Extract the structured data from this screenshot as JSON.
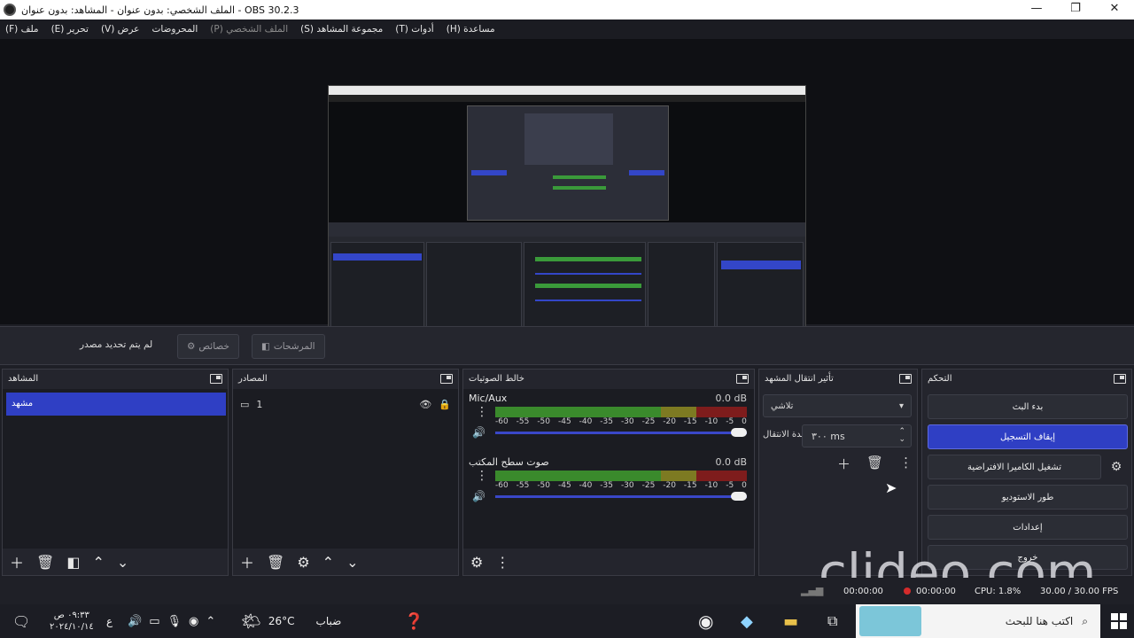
{
  "window": {
    "title": "الملف الشخصي: بدون عنوان - المشاهد: بدون عنوان - OBS 30.2.3",
    "minimize": "—",
    "restore": "❐",
    "close": "✕"
  },
  "menu": {
    "file": "(F) ملف",
    "edit": "(E) تحرير",
    "view": "(V) عرض",
    "docks": "المحروضات",
    "profile": "(P) الملف الشخصي",
    "scene_collection": "(S) مجموعة المشاهد",
    "tools": "(T) أدوات",
    "help": "(H) مساعدة"
  },
  "toolbar": {
    "no_source": "لم يتم تحديد مصدر",
    "properties": "خصائص",
    "filters": "المرشحات"
  },
  "docks": {
    "scenes": {
      "title": "المشاهد",
      "items": [
        "مشهد"
      ]
    },
    "sources": {
      "title": "المصادر",
      "items": [
        {
          "name": "1"
        }
      ]
    },
    "mixer": {
      "title": "خالط الصوتيات",
      "channels": [
        {
          "name": "Mic/Aux",
          "db": "0.0 dB"
        },
        {
          "name": "صوت سطح المكتب",
          "db": "0.0 dB"
        }
      ],
      "ticks": [
        "-60",
        "-55",
        "-50",
        "-45",
        "-40",
        "-35",
        "-30",
        "-25",
        "-20",
        "-15",
        "-10",
        "-5",
        "0"
      ]
    },
    "transitions": {
      "title": "تأثير انتقال المشهد",
      "selected": "تلاشي",
      "duration_label": "مدة الانتقال",
      "duration_value": "٣٠٠ ms"
    },
    "controls": {
      "title": "التحكم",
      "start_stream": "بدء البث",
      "stop_recording": "إيقاف التسجيل",
      "virtual_camera": "تشغيل الكاميرا الافتراضية",
      "studio_mode": "طور الاستوديو",
      "settings": "إعدادات",
      "exit": "خروج"
    }
  },
  "status": {
    "stream_time": "00:00:00",
    "rec_time": "00:00:00",
    "cpu": "CPU: 1.8%",
    "fps": "30.00 / 30.00 FPS"
  },
  "watermark": "clideo.com",
  "taskbar": {
    "time": "٠٩:٣٣ ص",
    "date": "٢٠٢٤/١٠/١٤",
    "lang": "ع",
    "weather_temp": "26°C",
    "weather_text": "ضباب",
    "search_placeholder": "اكتب هنا للبحث"
  },
  "colors": {
    "accent": "#2f3fc4",
    "meter_green": "#3a8a2c",
    "meter_yellow": "#7d7a22",
    "meter_red": "#7e1c1c"
  }
}
